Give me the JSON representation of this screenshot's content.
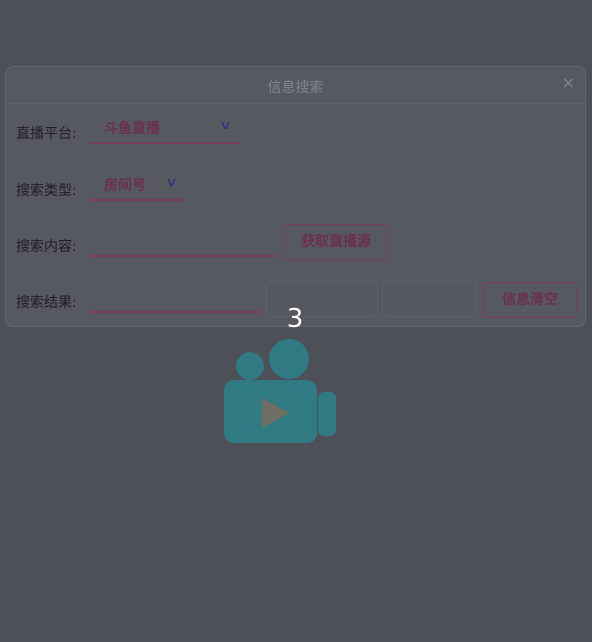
{
  "dialog": {
    "title": "信息搜索",
    "close_glyph": "×",
    "platform": {
      "label": "直播平台:",
      "value": "斗鱼直播",
      "caret_icon": "chevron-down"
    },
    "search_type": {
      "label": "搜索类型:",
      "value": "房间号",
      "caret_icon": "chevron-down"
    },
    "search_content": {
      "label": "搜索内容:",
      "value": "",
      "placeholder": ""
    },
    "get_source_button": "获取直播源",
    "search_result": {
      "label": "搜索结果:",
      "value": ""
    },
    "clear_button": "信息清空"
  },
  "countdown": "3",
  "logo_icon": "video-camera",
  "colors": {
    "accent": "#6b2f4f",
    "underline": "#7a3d5d",
    "logo": "#2f7a83",
    "overlay_background": "#4e5058"
  }
}
